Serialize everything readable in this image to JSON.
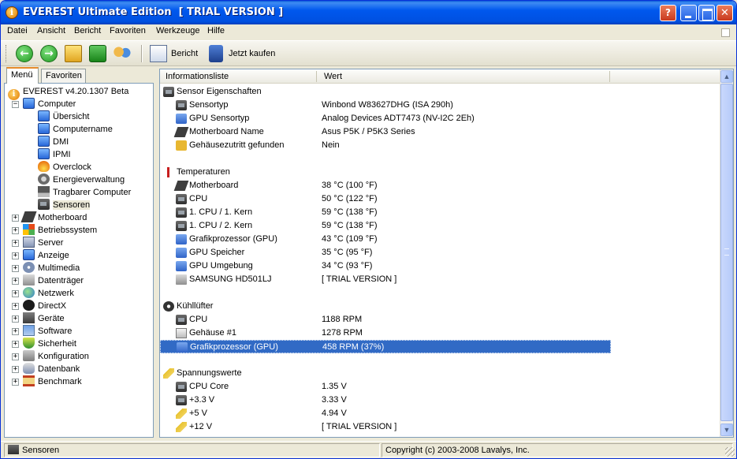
{
  "window": {
    "title": "EVEREST Ultimate Edition  [ TRIAL VERSION ]",
    "help_button": "?",
    "close_button": "✕"
  },
  "menubar": [
    "Datei",
    "Ansicht",
    "Bericht",
    "Favoriten",
    "Werkzeuge",
    "Hilfe"
  ],
  "toolbar": {
    "back_glyph": "←",
    "forward_glyph": "→",
    "report_label": "Bericht",
    "buy_label": "Jetzt kaufen"
  },
  "tabs": [
    "Menü",
    "Favoriten"
  ],
  "tree": {
    "root": {
      "label": "EVEREST v4.20.1307 Beta",
      "icon": "info-icon"
    },
    "computer": {
      "label": "Computer",
      "expander": "−"
    },
    "computer_children": [
      {
        "label": "Übersicht",
        "icon": "monitor-icon"
      },
      {
        "label": "Computername",
        "icon": "monitor-icon"
      },
      {
        "label": "DMI",
        "icon": "monitor-icon"
      },
      {
        "label": "IPMI",
        "icon": "monitor-icon"
      },
      {
        "label": "Overclock",
        "icon": "flame-icon"
      },
      {
        "label": "Energieverwaltung",
        "icon": "cog-icon"
      },
      {
        "label": "Tragbarer Computer",
        "icon": "laptop-icon"
      },
      {
        "label": "Sensoren",
        "icon": "chip-icon"
      }
    ],
    "categories": [
      {
        "label": "Motherboard",
        "icon": "board-icon"
      },
      {
        "label": "Betriebssystem",
        "icon": "windows-icon"
      },
      {
        "label": "Server",
        "icon": "server-icon"
      },
      {
        "label": "Anzeige",
        "icon": "monitor-icon"
      },
      {
        "label": "Multimedia",
        "icon": "media-icon"
      },
      {
        "label": "Datenträger",
        "icon": "hdd-icon"
      },
      {
        "label": "Netzwerk",
        "icon": "globe-icon"
      },
      {
        "label": "DirectX",
        "icon": "directx-icon"
      },
      {
        "label": "Geräte",
        "icon": "devices-icon"
      },
      {
        "label": "Software",
        "icon": "software-icon"
      },
      {
        "label": "Sicherheit",
        "icon": "shield-icon"
      },
      {
        "label": "Konfiguration",
        "icon": "config-icon"
      },
      {
        "label": "Datenbank",
        "icon": "database-icon"
      },
      {
        "label": "Benchmark",
        "icon": "hourglass-icon"
      }
    ],
    "expander_plus": "+"
  },
  "list": {
    "col_info": "Informationsliste",
    "col_value": "Wert",
    "sections": [
      {
        "title": "Sensor Eigenschaften",
        "icon": "chip-icon",
        "rows": [
          {
            "name": "Sensortyp",
            "value": "Winbond W83627DHG  (ISA 290h)",
            "icon": "chip-icon"
          },
          {
            "name": "GPU Sensortyp",
            "value": "Analog Devices ADT7473  (NV-I2C 2Eh)",
            "icon": "gpu-icon"
          },
          {
            "name": "Motherboard Name",
            "value": "Asus P5K / P5K3 Series",
            "icon": "board-icon"
          },
          {
            "name": "Gehäusezutritt gefunden",
            "value": "Nein",
            "icon": "lock-icon"
          }
        ]
      },
      {
        "title": "Temperaturen",
        "icon": "thermometer-icon",
        "rows": [
          {
            "name": "Motherboard",
            "value": "38 °C  (100 °F)",
            "icon": "board-icon"
          },
          {
            "name": "CPU",
            "value": "50 °C  (122 °F)",
            "icon": "chip-icon"
          },
          {
            "name": "1. CPU / 1. Kern",
            "value": "59 °C  (138 °F)",
            "icon": "chip-icon"
          },
          {
            "name": "1. CPU / 2. Kern",
            "value": "59 °C  (138 °F)",
            "icon": "chip-icon"
          },
          {
            "name": "Grafikprozessor (GPU)",
            "value": "43 °C  (109 °F)",
            "icon": "gpu-icon"
          },
          {
            "name": "GPU Speicher",
            "value": "35 °C  (95 °F)",
            "icon": "gpu-icon"
          },
          {
            "name": "GPU Umgebung",
            "value": "34 °C  (93 °F)",
            "icon": "gpu-icon"
          },
          {
            "name": "SAMSUNG HD501LJ",
            "value": "[ TRIAL VERSION ]",
            "icon": "hdd-icon"
          }
        ]
      },
      {
        "title": "Kühllüfter",
        "icon": "fan-icon",
        "rows": [
          {
            "name": "CPU",
            "value": "1188 RPM",
            "icon": "chip-icon"
          },
          {
            "name": "Gehäuse #1",
            "value": "1278 RPM",
            "icon": "case-icon"
          },
          {
            "name": "Grafikprozessor (GPU)",
            "value": "458 RPM  (37%)",
            "icon": "gpu-icon",
            "selected": true
          }
        ]
      },
      {
        "title": "Spannungswerte",
        "icon": "voltage-icon",
        "rows": [
          {
            "name": "CPU Core",
            "value": "1.35 V",
            "icon": "chip-icon"
          },
          {
            "name": "+3.3 V",
            "value": "3.33 V",
            "icon": "chip-icon"
          },
          {
            "name": "+5 V",
            "value": "4.94 V",
            "icon": "voltage-icon"
          },
          {
            "name": "+12 V",
            "value": "[ TRIAL VERSION ]",
            "icon": "voltage-icon"
          }
        ]
      }
    ]
  },
  "statusbar": {
    "left": "Sensoren",
    "right": "Copyright (c) 2003-2008 Lavalys, Inc."
  },
  "colors": {
    "selection": "#316ac5",
    "titlebar": "#0058ee",
    "panel_border": "#7f9db9"
  }
}
